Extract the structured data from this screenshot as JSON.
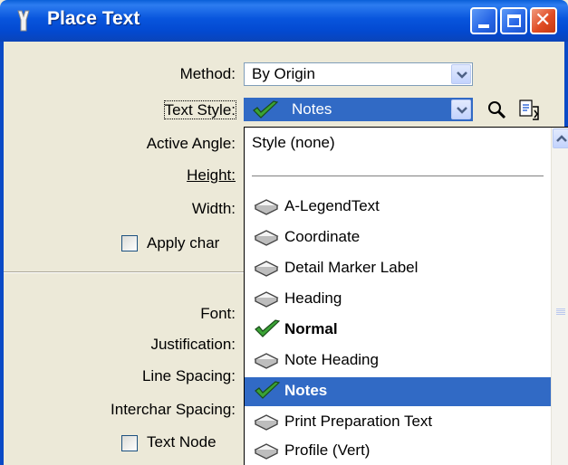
{
  "window": {
    "title": "Place Text"
  },
  "form": {
    "method": {
      "label": "Method:",
      "value": "By Origin"
    },
    "text_style": {
      "label": "Text Style:",
      "value": "Notes"
    },
    "active_angle": {
      "label": "Active Angle:"
    },
    "height": {
      "label": "Height:"
    },
    "width": {
      "label": "Width:"
    },
    "apply_changes": {
      "label": "Apply char"
    },
    "font": {
      "label": "Font:"
    },
    "justification": {
      "label": "Justification:"
    },
    "line_spacing": {
      "label": "Line Spacing:"
    },
    "interchar_spacing": {
      "label": "Interchar Spacing:"
    },
    "text_node": {
      "label": "Text Node"
    }
  },
  "dropdown": {
    "none_item": "Style (none)",
    "items": [
      {
        "label": "A-LegendText",
        "icon": "text-style-icon"
      },
      {
        "label": "Coordinate",
        "icon": "text-style-icon"
      },
      {
        "label": "Detail Marker Label",
        "icon": "text-style-icon"
      },
      {
        "label": "Heading",
        "icon": "text-style-icon"
      },
      {
        "label": "Normal",
        "icon": "checkmark-icon"
      },
      {
        "label": "Note Heading",
        "icon": "text-style-icon"
      },
      {
        "label": "Notes",
        "icon": "checkmark-icon"
      },
      {
        "label": "Print Preparation Text",
        "icon": "text-style-icon"
      },
      {
        "label": "Profile (Vert)",
        "icon": "text-style-icon"
      }
    ]
  },
  "colors": {
    "titlebar": "#0855dd",
    "selection": "#316ac5",
    "dialog_bg": "#ece9d8",
    "check_green": "#3aa335"
  }
}
